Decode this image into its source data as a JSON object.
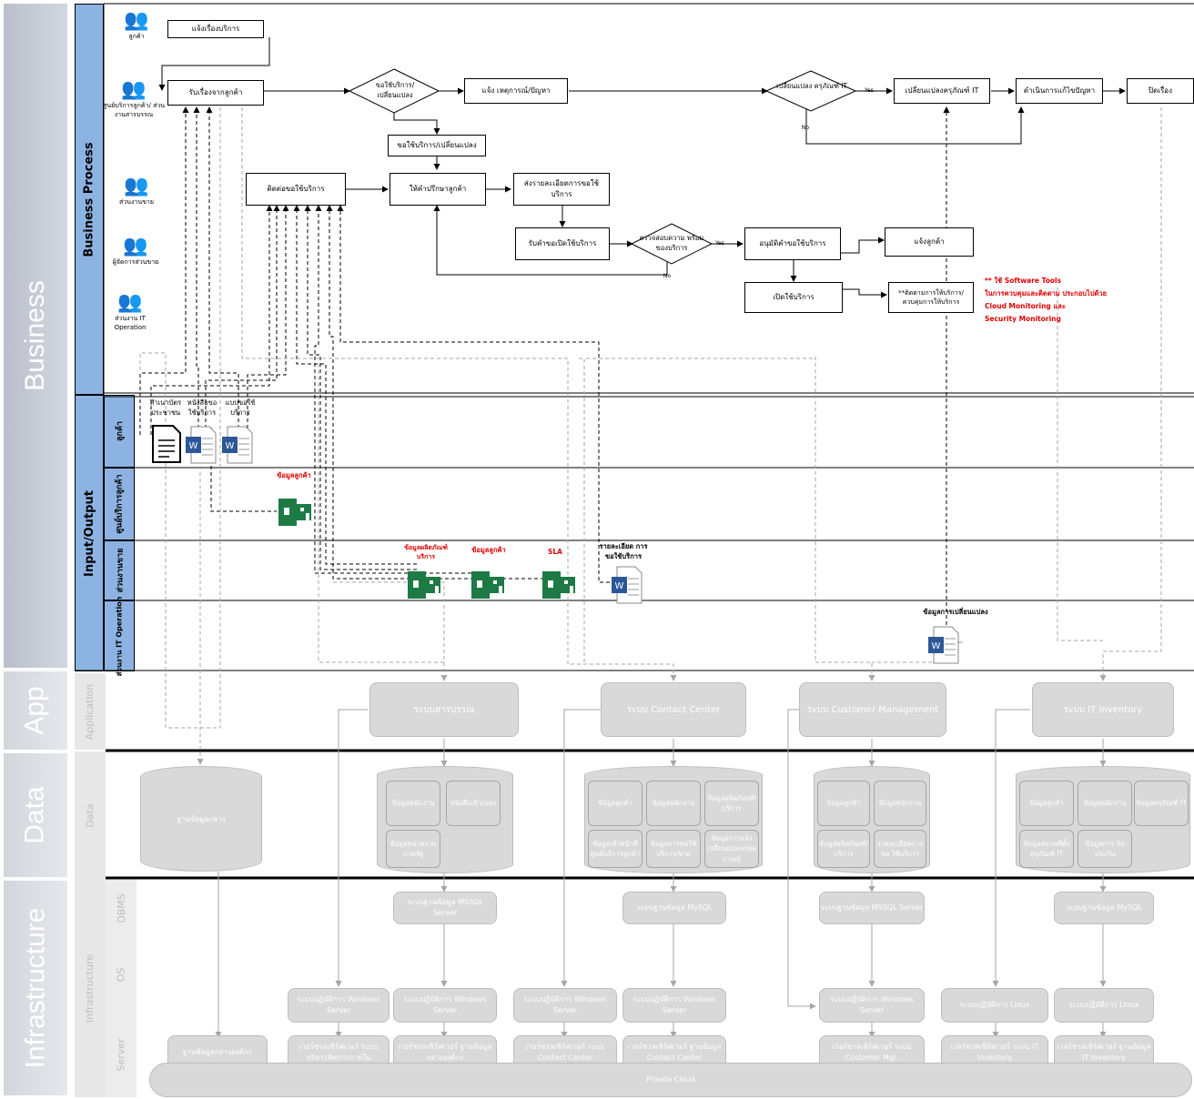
{
  "layers": {
    "business": "Business",
    "app": "App",
    "data": "Data",
    "infrastructure": "Infrastructure"
  },
  "lanes": {
    "business_process": "Business Process",
    "input_output": "Input/Output",
    "application": "Application",
    "data": "Data",
    "infrastructure": "Infrastructure",
    "dbms": "DBMS",
    "os": "OS",
    "server": "Server"
  },
  "io_lanes": {
    "customer": "ลูกค้า",
    "service_center": "ศูนย์บริการลูกค้า",
    "sales": "ส่วนงานขาย",
    "it_operation": "ส่วนงาน IT Operation"
  },
  "actors": {
    "customer": "ลูกค้า",
    "service_center": "ศูนย์บริการลูกค้า/ ส่วนงานสารบรรณ",
    "sales": "ส่วนงานขาย",
    "sales_manager": "ผู้จัดการส่วนขาย",
    "it_operation": "ส่วนงาน IT Operation"
  },
  "process": {
    "notify": "แจ้งเรื่องบริการ",
    "receive": "รับเรื่องจากลูกค้า",
    "decision_request": "ขอใช้บริการ/ เปลี่ยนแปลง",
    "report_incident": "แจ้ง เหตุการณ์/ปัญหา",
    "decision_change": "เปลี่ยนแปลง ครุภัณฑ์ IT",
    "change_equipment": "เปลี่ยนแปลงครุภัณฑ์ IT",
    "solve": "ดำเนินการแก้ไขปัญหา",
    "close": "ปิดเรื่อง",
    "request_change": "ขอใช้บริการ/เปลี่ยนแปลง",
    "contact": "ติดต่อขอใช้บริการ",
    "advise": "ให้คำปรึกษาลูกค้า",
    "send_detail": "ส่งรายละเอียดการขอใช้บริการ",
    "receive_open": "รับคำขอเปิดใช้บริการ",
    "check_ready": "ตรวจสอบความ พร้อมของบริการ",
    "approve": "อนุมัติคำขอใช้บริการ",
    "notify_customer": "แจ้งลูกค้า",
    "open_service": "เปิดใช้บริการ",
    "monitor": "**ติดตามการให้บริการ/ ควบคุมการให้บริการ",
    "yes": "Yes",
    "no": "No"
  },
  "note": {
    "l1": "** ใช้ Software Tools",
    "l2": "ในการควบคุมและติดตาม ประกอบไปด้วย",
    "l3": "Cloud Monitoring และ",
    "l4": "Security Monitoring"
  },
  "docs": {
    "id_card": "สำเนาบัตร ประชาชน",
    "request_letter": "หนังสือขอ ใช้บริการ",
    "form": "แบบขอใช้ บริการ",
    "customer_data_1": "ข้อมูลลูกค้า",
    "product_data": "ข้อมูลผลิตภัณฑ์ บริการ",
    "customer_data_2": "ข้อมูลลูกค้า",
    "sla": "SLA",
    "request_detail": "รายละเอียด การขอใช้บริการ",
    "change_data": "ข้อมูลการเปลี่ยนแปลง"
  },
  "apps": {
    "saraban": "ระบบสารบรรณ",
    "contact_center": "ระบบ Contact Center",
    "customer_mgmt": "ระบบ Customer Management",
    "it_inventory": "ระบบ IT Inventory"
  },
  "databases": {
    "central": "ฐานข้อมูลกลาง",
    "saraban": [
      "ข้อมูลพนักงาน",
      "หนังสือเข้า/ออก",
      "ข้อมูลหน่วยงาน ภาครัฐ"
    ],
    "contact": [
      "ข้อมูลลูกค้า",
      "ข้อมูลพนักงาน",
      "ข้อมูลผลิตภัณฑ์/ บริการ",
      "ข้อมูลเจ้าหน้าที่ ศูนย์บริการลูกค้า",
      "ข้อมูลการขอใช้ บริการ/ขาย",
      "ข้อมูลการแจ้ง เปลี่ยนแปลง/เหตุ การณ์"
    ],
    "customer": [
      "ข้อมูลลูกค้า",
      "ข้อมูลพนักงาน",
      "ข้อมูลผลิตภัณฑ์/ บริการ",
      "รายละเอียดการขอ ใช้บริการ"
    ],
    "inventory": [
      "ข้อมูลลูกค้า",
      "ข้อมูลพนักงาน",
      "ข้อมูลครุภัณฑ์ IT",
      "ข้อมูลสถานที่ตั้ง ครุภัณฑ์ IT",
      "ข้อมูลการ รับประกัน"
    ]
  },
  "infra": {
    "dbms_saraban": "ระบบฐานข้อมูล MSSQL Server",
    "dbms_contact": "ระบบฐานข้อมูล MySQL",
    "dbms_customer": "ระบบฐานข้อมูล MSSQL Server",
    "dbms_inventory": "ระบบฐานข้อมูล MySQL",
    "os_1": "ระบบปฏิบัติการ Windows Server",
    "os_2": "ระบบปฏิบัติการ Windows Server",
    "os_3": "ระบบปฏิบัติการ Windows Server",
    "os_4": "ระบบปฏิบัติการ Windows Server",
    "os_5": "ระบบปฏิบัติการ Windows Server",
    "os_6": "ระบบปฏิบัติการ Linux",
    "os_7": "ระบบปฏิบัติการ Linux",
    "srv_central": "ฐานข้อมูลกลางองค์กร",
    "srv_1": "เวอร์ชวลเซิร์ฟเวอร์ ระบบบริหารจัดการภายใน",
    "srv_2": "เวอร์ชวลเซิร์ฟเวอร์ ฐานข้อมูลกลางองค์กร",
    "srv_3": "เวอร์ชวลเซิร์ฟเวอร์ ระบบ Contact Center",
    "srv_4": "เวอร์ชวลเซิร์ฟเวอร์ ฐานข้อมูล Contact Center",
    "srv_5": "เวอร์ชวลเซิร์ฟเวอร์ ระบบ Customer Mgt.",
    "srv_6": "เวอร์ชวลเซิร์ฟเวอร์ ระบบ IT Inventory",
    "srv_7": "เวอร์ชวลเซิร์ฟเวอร์ ฐานข้อมูล IT Inventory",
    "cloud": "Private Cloud"
  },
  "colors": {
    "band": "#c9ced8",
    "lane_blue": "#8db3e2",
    "grey": "#d9d9d9",
    "excel": "#1d7a45",
    "word": "#2b5797",
    "red": "#e00000"
  }
}
